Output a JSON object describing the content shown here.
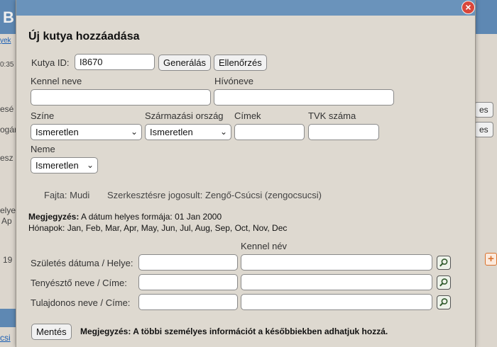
{
  "background": {
    "header_letter": "B",
    "link_frag": "yek",
    "time_frag": "0:35",
    "frag_ese": "esé",
    "frag_ogar": "ogár",
    "frag_esz": "esz",
    "frag_elye": "elye",
    "frag_ap": "Ap",
    "frag_19": "19",
    "frag_csi": "csi",
    "frag_es1": "es",
    "frag_es2": "es",
    "plus": "+"
  },
  "modal": {
    "close_label": "×",
    "title": "Új kutya hozzáadása",
    "dog_id_label": "Kutya ID:",
    "dog_id_value": "I8670",
    "generate_label": "Generálás",
    "check_label": "Ellenőrzés",
    "kennel_name_label": "Kennel neve",
    "kennel_name_value": "",
    "call_name_label": "Hívóneve",
    "call_name_value": "",
    "color_label": "Színe",
    "color_value": "Ismeretlen",
    "origin_label": "Származási ország",
    "origin_value": "Ismeretlen",
    "titles_label": "Címek",
    "titles_value": "",
    "tvk_label": "TVK száma",
    "tvk_value": "",
    "sex_label": "Neme",
    "sex_value": "Ismeretlen",
    "breed_info": "Fajta: Mudi",
    "editor_info": "Szerkesztésre jogosult: Zengő-Csúcsi (zengocsucsi)",
    "note1_bold": "Megjegyzés:",
    "note1_text": " A dátum helyes formája: 01 Jan 2000",
    "note2_text": "Hónapok: Jan, Feb, Mar, Apr, May, Jun, Jul, Aug, Sep, Oct, Nov, Dec",
    "kennel_col_label": "Kennel név",
    "birth_label": "Születés dátuma / Helye:",
    "breeder_label": "Tenyésztő neve / Címe:",
    "owner_label": "Tulajdonos neve / Címe:",
    "save_label": "Mentés",
    "footer_note": "Megjegyzés: A többi személyes információt a későbbiekben adhatjuk hozzá."
  },
  "icons": {
    "search_icon": "magnifier-icon",
    "chevron": "chevron-down-icon"
  }
}
